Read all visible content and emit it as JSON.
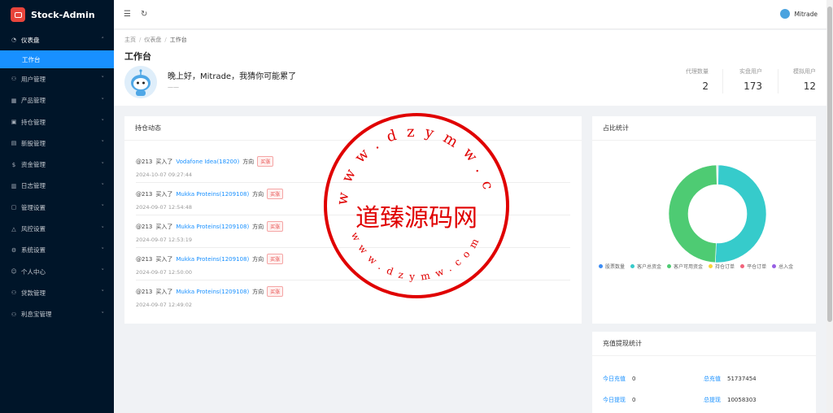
{
  "brand": {
    "name": "Stock-Admin"
  },
  "sidebar": {
    "items": [
      {
        "label": "仪表盘",
        "icon": "dashboard-icon",
        "open": true,
        "sub": [
          "工作台"
        ]
      },
      {
        "label": "用户管理",
        "icon": "user-icon"
      },
      {
        "label": "产品管理",
        "icon": "product-icon"
      },
      {
        "label": "持仓管理",
        "icon": "position-icon"
      },
      {
        "label": "新股管理",
        "icon": "ipo-icon"
      },
      {
        "label": "资金管理",
        "icon": "money-icon"
      },
      {
        "label": "日志管理",
        "icon": "log-icon"
      },
      {
        "label": "管理设置",
        "icon": "settings-icon"
      },
      {
        "label": "风控设置",
        "icon": "risk-icon"
      },
      {
        "label": "系统设置",
        "icon": "system-icon"
      },
      {
        "label": "个人中心",
        "icon": "profile-icon"
      },
      {
        "label": "贷款管理",
        "icon": "loan-icon"
      },
      {
        "label": "利息宝管理",
        "icon": "interest-icon"
      }
    ]
  },
  "header": {
    "user_name": "Mitrade"
  },
  "breadcrumb": {
    "home": "主页",
    "level2": "仪表盘",
    "current": "工作台"
  },
  "page": {
    "title": "工作台",
    "greeting": "晚上好，Mitrade，我猜你可能累了",
    "greeting_sub": "——"
  },
  "stats": [
    {
      "label": "代理数量",
      "value": "2"
    },
    {
      "label": "实盘用户",
      "value": "173"
    },
    {
      "label": "模拟用户",
      "value": "12"
    }
  ],
  "positions": {
    "title": "持仓动态",
    "items": [
      {
        "user": "@213",
        "action": "买入了",
        "stock": "Vodafone Idea(18200)",
        "dir_label": "方向",
        "tag": "买涨",
        "time": "2024-10-07 09:27:44"
      },
      {
        "user": "@213",
        "action": "买入了",
        "stock": "Mukka Proteins(1209108)",
        "dir_label": "方向",
        "tag": "买涨",
        "time": "2024-09-07 12:54:48"
      },
      {
        "user": "@213",
        "action": "买入了",
        "stock": "Mukka Proteins(1209108)",
        "dir_label": "方向",
        "tag": "买涨",
        "time": "2024-09-07 12:53:19"
      },
      {
        "user": "@213",
        "action": "买入了",
        "stock": "Mukka Proteins(1209108)",
        "dir_label": "方向",
        "tag": "买涨",
        "time": "2024-09-07 12:50:00"
      },
      {
        "user": "@213",
        "action": "买入了",
        "stock": "Mukka Proteins(1209108)",
        "dir_label": "方向",
        "tag": "买涨",
        "time": "2024-09-07 12:49:02"
      }
    ]
  },
  "share_card": {
    "title": "占比统计"
  },
  "chart_data": {
    "type": "pie",
    "donut": true,
    "labels": [
      "股票数量",
      "客户总资金",
      "客户可用资金",
      "持仓订单",
      "平仓订单",
      "总入金"
    ],
    "colors": [
      "#3b8cf5",
      "#36cbcb",
      "#4ecb73",
      "#fad337",
      "#f2637b",
      "#975fe4"
    ],
    "values": [
      0.3,
      50.4,
      49.0,
      0.1,
      0.1,
      0.1
    ]
  },
  "recharge": {
    "title": "充值提现统计",
    "rows": [
      {
        "label": "今日充值",
        "value": "0"
      },
      {
        "label": "总充值",
        "value": "51737454"
      },
      {
        "label": "今日提现",
        "value": "0"
      },
      {
        "label": "总提现",
        "value": "10058303"
      }
    ]
  },
  "watermark": {
    "top_arc": "www.dzymw.com",
    "center": "道臻源码网",
    "bottom_arc": "www.dzymw.com",
    "color": "#e00000"
  }
}
